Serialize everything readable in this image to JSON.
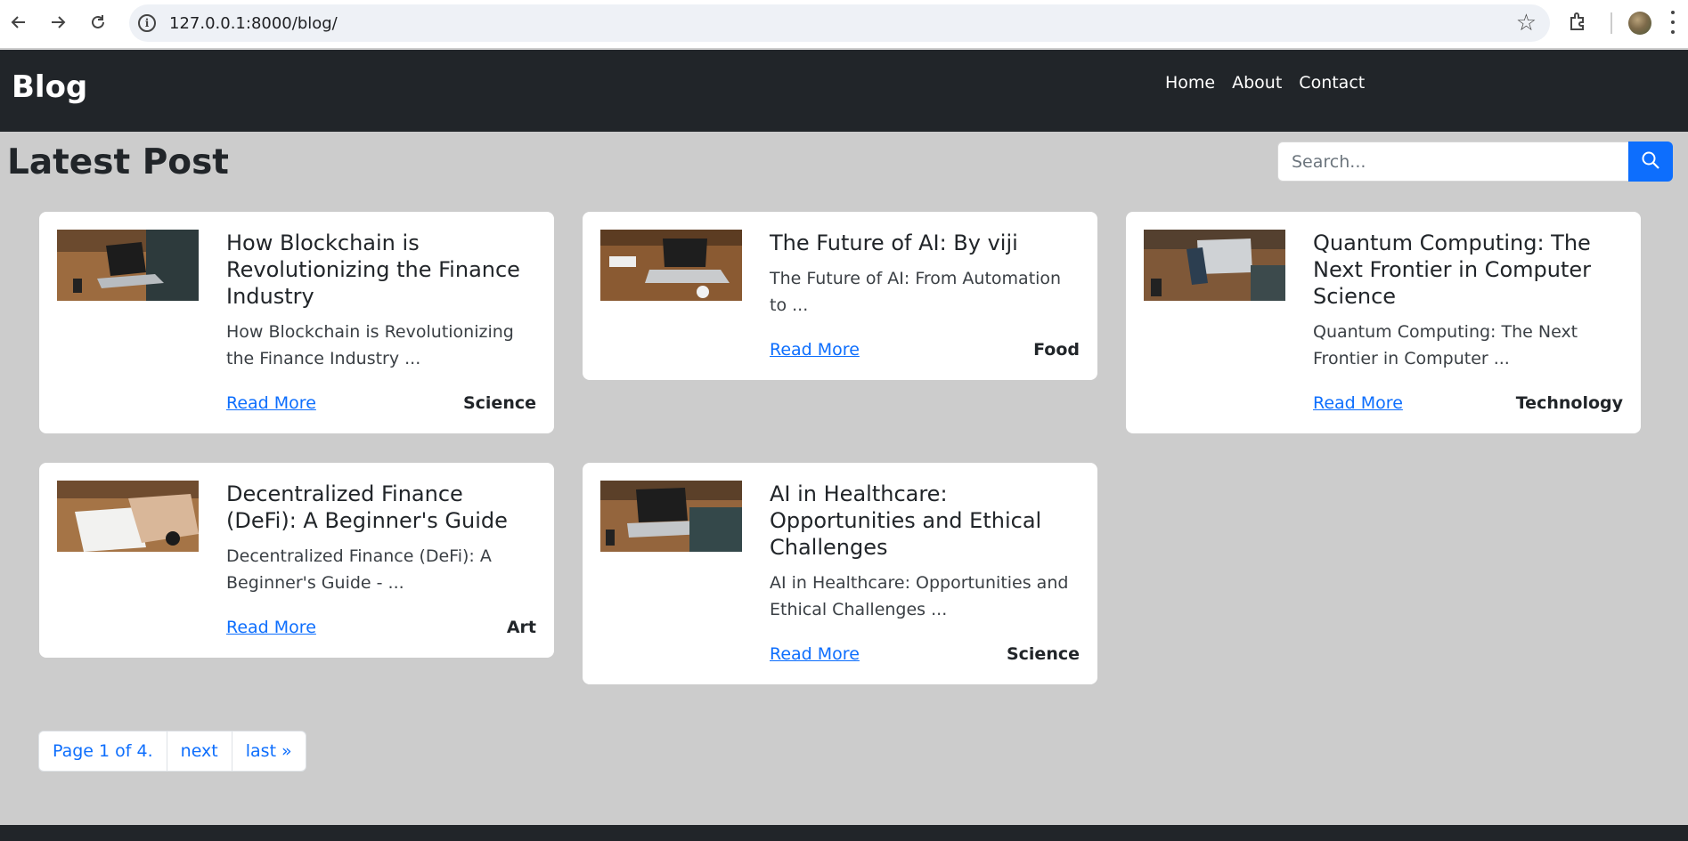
{
  "browser": {
    "url": "127.0.0.1:8000/blog/"
  },
  "header": {
    "brand": "Blog",
    "nav": [
      "Home",
      "About",
      "Contact"
    ]
  },
  "main": {
    "title": "Latest Post",
    "search_placeholder": "Search..."
  },
  "posts": [
    {
      "title": "How Blockchain is Revolutionizing the Finance Industry",
      "excerpt": "How Blockchain is Revolutionizing the Finance Industry ...",
      "read_more": "Read More",
      "category": "Science"
    },
    {
      "title": "The Future of AI: By viji",
      "excerpt": "The Future of AI: From Automation to ...",
      "read_more": "Read More",
      "category": "Food"
    },
    {
      "title": "Quantum Computing: The Next Frontier in Computer Science",
      "excerpt": "Quantum Computing: The Next Frontier in Computer ...",
      "read_more": "Read More",
      "category": "Technology"
    },
    {
      "title": "Decentralized Finance (DeFi): A Beginner's Guide",
      "excerpt": "Decentralized Finance (DeFi): A Beginner's Guide - ...",
      "read_more": "Read More",
      "category": "Art"
    },
    {
      "title": "AI in Healthcare: Opportunities and Ethical Challenges",
      "excerpt": "AI in Healthcare: Opportunities and Ethical Challenges ...",
      "read_more": "Read More",
      "category": "Science"
    }
  ],
  "pagination": {
    "current": "Page 1 of 4.",
    "next": "next",
    "last": "last »"
  },
  "colors": {
    "header_bg": "#212529",
    "page_bg": "#cccccc",
    "accent": "#0d6efd"
  }
}
